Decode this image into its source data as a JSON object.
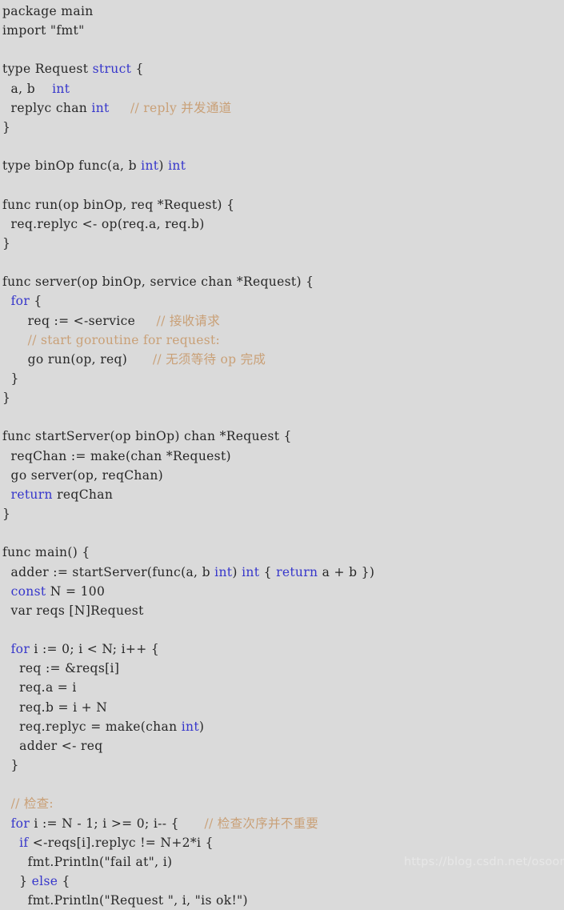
{
  "meta": {
    "language": "Go",
    "background_color": "#dadada",
    "text_color": "#272727",
    "keyword_color": "#3636cb",
    "comment_color": "#c9a077",
    "watermark_color": "#e7e7e7"
  },
  "watermark": {
    "text": "https://blog.csdn.net/osoon"
  },
  "code": {
    "lines": [
      {
        "id": 1,
        "segments": [
          {
            "t": "package main",
            "c": "txt"
          }
        ]
      },
      {
        "id": 2,
        "segments": [
          {
            "t": "import \"fmt\"",
            "c": "txt"
          }
        ]
      },
      {
        "id": 3,
        "segments": [
          {
            "t": "",
            "c": "txt"
          }
        ]
      },
      {
        "id": 4,
        "segments": [
          {
            "t": "type Request ",
            "c": "txt"
          },
          {
            "t": "struct",
            "c": "kw"
          },
          {
            "t": " {",
            "c": "txt"
          }
        ]
      },
      {
        "id": 5,
        "segments": [
          {
            "t": "  a, b    ",
            "c": "txt"
          },
          {
            "t": "int",
            "c": "kw"
          }
        ]
      },
      {
        "id": 6,
        "segments": [
          {
            "t": "  replyc chan ",
            "c": "txt"
          },
          {
            "t": "int",
            "c": "kw"
          },
          {
            "t": "     ",
            "c": "txt"
          },
          {
            "t": "// reply 并发通道",
            "c": "cmt"
          }
        ]
      },
      {
        "id": 7,
        "segments": [
          {
            "t": "}",
            "c": "txt"
          }
        ]
      },
      {
        "id": 8,
        "segments": [
          {
            "t": "",
            "c": "txt"
          }
        ]
      },
      {
        "id": 9,
        "segments": [
          {
            "t": "type binOp func(a, b ",
            "c": "txt"
          },
          {
            "t": "int",
            "c": "kw"
          },
          {
            "t": ") ",
            "c": "txt"
          },
          {
            "t": "int",
            "c": "kw"
          }
        ]
      },
      {
        "id": 10,
        "segments": [
          {
            "t": "",
            "c": "txt"
          }
        ]
      },
      {
        "id": 11,
        "segments": [
          {
            "t": "func run(op binOp, req *Request) {",
            "c": "txt"
          }
        ]
      },
      {
        "id": 12,
        "segments": [
          {
            "t": "  req.replyc <- op(req.a, req.b)",
            "c": "txt"
          }
        ]
      },
      {
        "id": 13,
        "segments": [
          {
            "t": "}",
            "c": "txt"
          }
        ]
      },
      {
        "id": 14,
        "segments": [
          {
            "t": "",
            "c": "txt"
          }
        ]
      },
      {
        "id": 15,
        "segments": [
          {
            "t": "func server(op binOp, service chan *Request) {",
            "c": "txt"
          }
        ]
      },
      {
        "id": 16,
        "segments": [
          {
            "t": "  ",
            "c": "txt"
          },
          {
            "t": "for",
            "c": "kw"
          },
          {
            "t": " {",
            "c": "txt"
          }
        ]
      },
      {
        "id": 17,
        "segments": [
          {
            "t": "      req := <-service     ",
            "c": "txt"
          },
          {
            "t": "// 接收请求",
            "c": "cmt"
          }
        ]
      },
      {
        "id": 18,
        "segments": [
          {
            "t": "      ",
            "c": "txt"
          },
          {
            "t": "// start goroutine for request:",
            "c": "cmt"
          }
        ]
      },
      {
        "id": 19,
        "segments": [
          {
            "t": "      go run(op, req)      ",
            "c": "txt"
          },
          {
            "t": "// 无须等待 op 完成",
            "c": "cmt"
          }
        ]
      },
      {
        "id": 20,
        "segments": [
          {
            "t": "  }",
            "c": "txt"
          }
        ]
      },
      {
        "id": 21,
        "segments": [
          {
            "t": "}",
            "c": "txt"
          }
        ]
      },
      {
        "id": 22,
        "segments": [
          {
            "t": "",
            "c": "txt"
          }
        ]
      },
      {
        "id": 23,
        "segments": [
          {
            "t": "func startServer(op binOp) chan *Request {",
            "c": "txt"
          }
        ]
      },
      {
        "id": 24,
        "segments": [
          {
            "t": "  reqChan := make(chan *Request)",
            "c": "txt"
          }
        ]
      },
      {
        "id": 25,
        "segments": [
          {
            "t": "  go server(op, reqChan)",
            "c": "txt"
          }
        ]
      },
      {
        "id": 26,
        "segments": [
          {
            "t": "  ",
            "c": "txt"
          },
          {
            "t": "return",
            "c": "kw"
          },
          {
            "t": " reqChan",
            "c": "txt"
          }
        ]
      },
      {
        "id": 27,
        "segments": [
          {
            "t": "}",
            "c": "txt"
          }
        ]
      },
      {
        "id": 28,
        "segments": [
          {
            "t": "",
            "c": "txt"
          }
        ]
      },
      {
        "id": 29,
        "segments": [
          {
            "t": "func main() {",
            "c": "txt"
          }
        ]
      },
      {
        "id": 30,
        "segments": [
          {
            "t": "  adder := startServer(func(a, b ",
            "c": "txt"
          },
          {
            "t": "int",
            "c": "kw"
          },
          {
            "t": ") ",
            "c": "txt"
          },
          {
            "t": "int",
            "c": "kw"
          },
          {
            "t": " { ",
            "c": "txt"
          },
          {
            "t": "return",
            "c": "kw"
          },
          {
            "t": " a + b })",
            "c": "txt"
          }
        ]
      },
      {
        "id": 31,
        "segments": [
          {
            "t": "  ",
            "c": "txt"
          },
          {
            "t": "const",
            "c": "kw"
          },
          {
            "t": " N = 100",
            "c": "txt"
          }
        ]
      },
      {
        "id": 32,
        "segments": [
          {
            "t": "  var reqs [N]Request",
            "c": "txt"
          }
        ]
      },
      {
        "id": 33,
        "segments": [
          {
            "t": "",
            "c": "txt"
          }
        ]
      },
      {
        "id": 34,
        "segments": [
          {
            "t": "  ",
            "c": "txt"
          },
          {
            "t": "for",
            "c": "kw"
          },
          {
            "t": " i := 0; i < N; i++ {",
            "c": "txt"
          }
        ]
      },
      {
        "id": 35,
        "segments": [
          {
            "t": "    req := &reqs[i]",
            "c": "txt"
          }
        ]
      },
      {
        "id": 36,
        "segments": [
          {
            "t": "    req.a = i",
            "c": "txt"
          }
        ]
      },
      {
        "id": 37,
        "segments": [
          {
            "t": "    req.b = i + N",
            "c": "txt"
          }
        ]
      },
      {
        "id": 38,
        "segments": [
          {
            "t": "    req.replyc = make(chan ",
            "c": "txt"
          },
          {
            "t": "int",
            "c": "kw"
          },
          {
            "t": ")",
            "c": "txt"
          }
        ]
      },
      {
        "id": 39,
        "segments": [
          {
            "t": "    adder <- req",
            "c": "txt"
          }
        ]
      },
      {
        "id": 40,
        "segments": [
          {
            "t": "  }",
            "c": "txt"
          }
        ]
      },
      {
        "id": 41,
        "segments": [
          {
            "t": "",
            "c": "txt"
          }
        ]
      },
      {
        "id": 42,
        "segments": [
          {
            "t": "  ",
            "c": "txt"
          },
          {
            "t": "// 检查:",
            "c": "cmt"
          }
        ]
      },
      {
        "id": 43,
        "segments": [
          {
            "t": "  ",
            "c": "txt"
          },
          {
            "t": "for",
            "c": "kw"
          },
          {
            "t": " i := N - 1; i >= 0; i-- {      ",
            "c": "txt"
          },
          {
            "t": "// 检查次序并不重要",
            "c": "cmt"
          }
        ]
      },
      {
        "id": 44,
        "segments": [
          {
            "t": "    ",
            "c": "txt"
          },
          {
            "t": "if",
            "c": "kw"
          },
          {
            "t": " <-reqs[i].replyc != N+2*i {",
            "c": "txt"
          }
        ]
      },
      {
        "id": 45,
        "segments": [
          {
            "t": "      fmt.Println(\"fail at\", i)",
            "c": "txt"
          }
        ]
      },
      {
        "id": 46,
        "segments": [
          {
            "t": "    } ",
            "c": "txt"
          },
          {
            "t": "else",
            "c": "kw"
          },
          {
            "t": " {",
            "c": "txt"
          }
        ]
      },
      {
        "id": 47,
        "segments": [
          {
            "t": "      fmt.Println(\"Request \", i, \"is ok!\")",
            "c": "txt"
          }
        ]
      }
    ]
  }
}
